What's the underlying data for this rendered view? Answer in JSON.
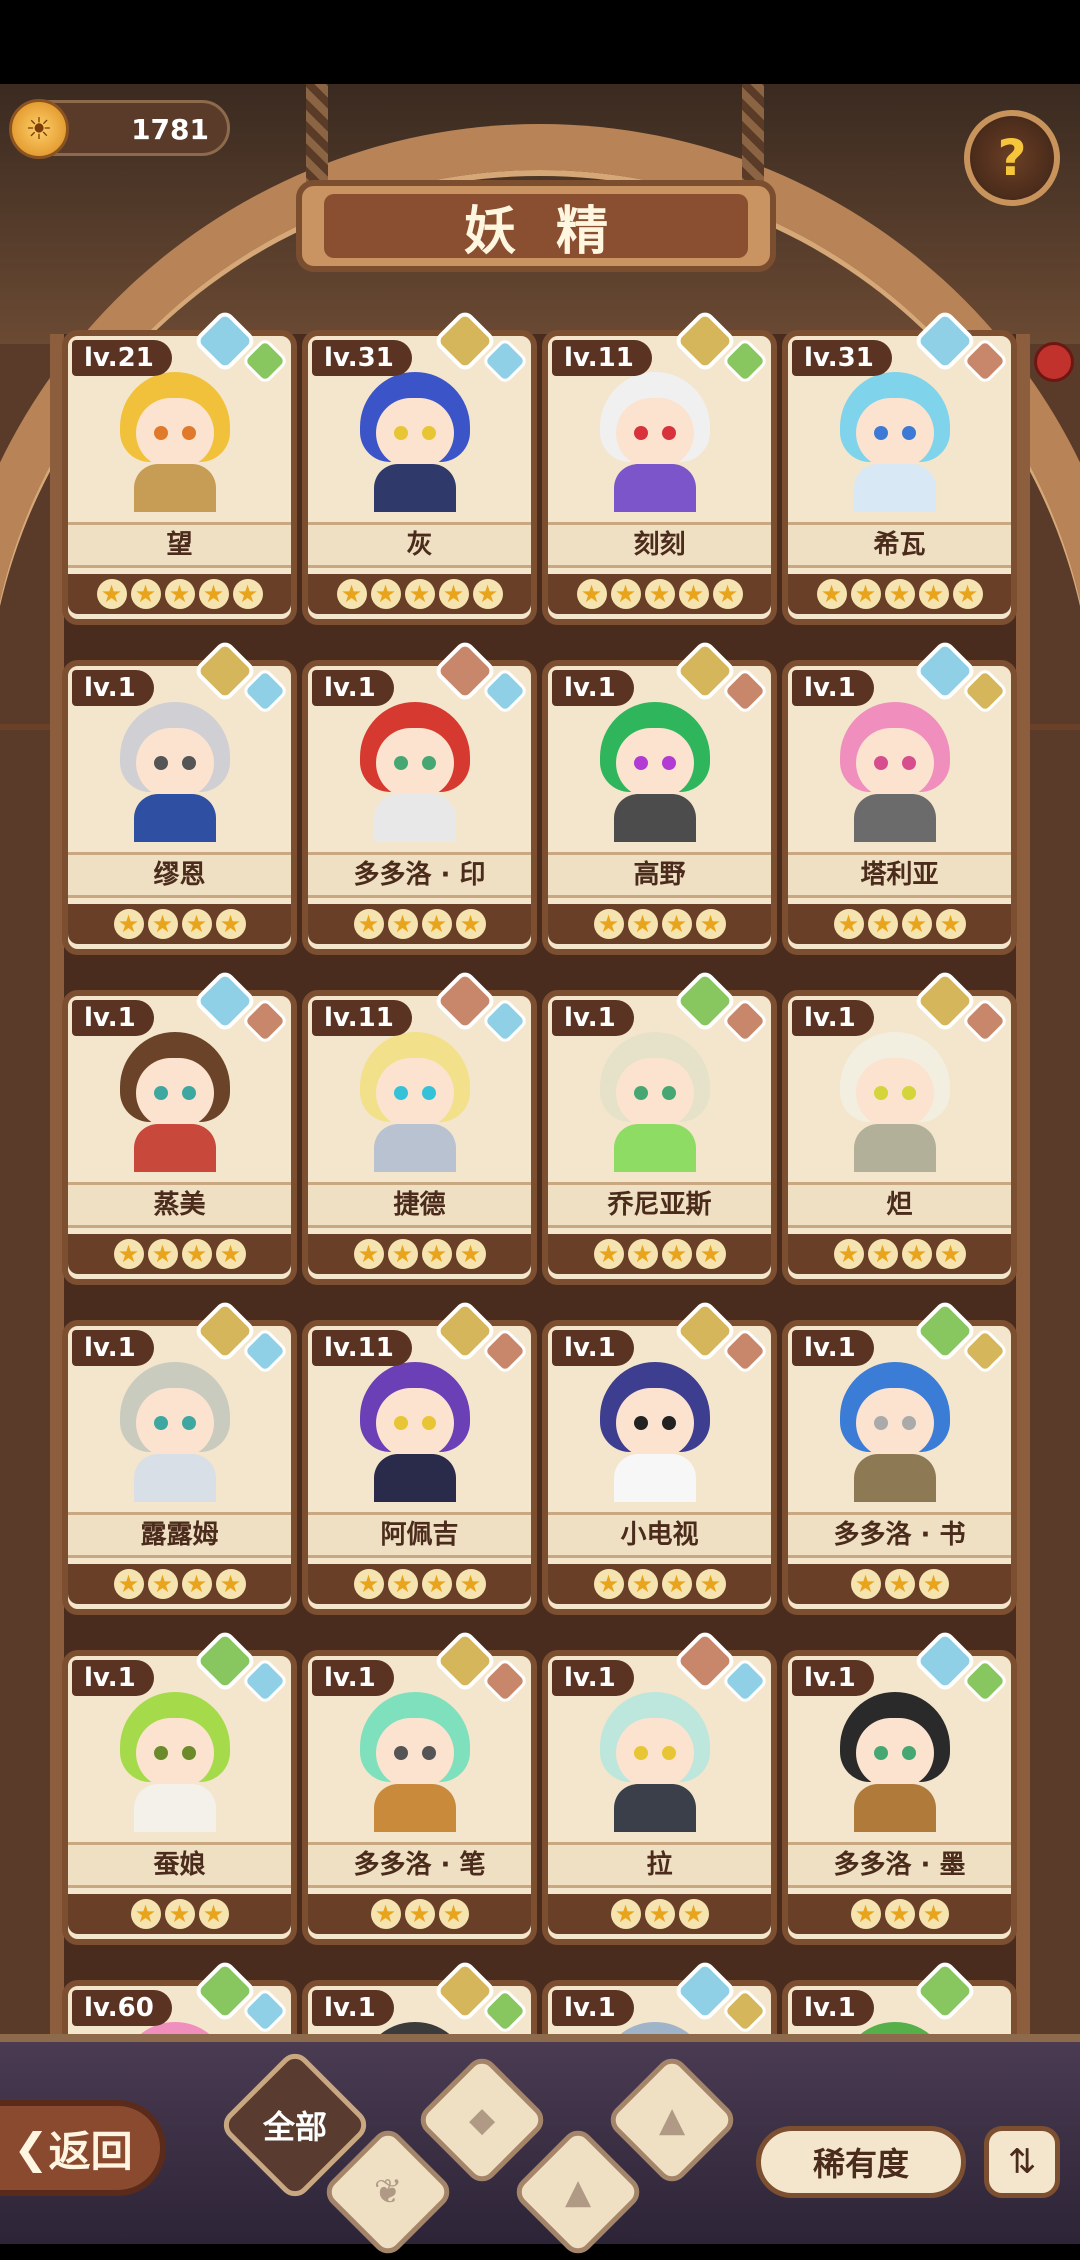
{
  "currency": {
    "value": "1781",
    "icon": "sun-coin-icon"
  },
  "title": "妖精",
  "help_icon": "question-mark-icon",
  "cards": [
    {
      "level": "lv.21",
      "name": "望",
      "stars": 5,
      "hair": "#f2c13b",
      "eye": "#e07a2a",
      "body": "#c79c55",
      "gem1": "water",
      "gem2": "plant"
    },
    {
      "level": "lv.31",
      "name": "灰",
      "stars": 5,
      "hair": "#3b55c9",
      "eye": "#e8c534",
      "body": "#2f3a6b",
      "gem1": "earth",
      "gem2": "water"
    },
    {
      "level": "lv.11",
      "name": "刻刻",
      "stars": 5,
      "hair": "#f1f0f0",
      "eye": "#d8333a",
      "body": "#7b55c9",
      "gem1": "earth",
      "gem2": "plant"
    },
    {
      "level": "lv.31",
      "name": "希瓦",
      "stars": 5,
      "hair": "#7fd3ea",
      "eye": "#3d7ad6",
      "body": "#d9e8f5",
      "gem1": "water",
      "gem2": "fire"
    },
    {
      "level": "lv.1",
      "name": "缪恩",
      "stars": 4,
      "hair": "#cfcfd4",
      "eye": "#555555",
      "body": "#2f4fa3",
      "gem1": "earth",
      "gem2": "water"
    },
    {
      "level": "lv.1",
      "name": "多多洛 · 印",
      "stars": 4,
      "hair": "#d6392f",
      "eye": "#46a773",
      "body": "#e8e8e8",
      "gem1": "fire",
      "gem2": "water"
    },
    {
      "level": "lv.1",
      "name": "高野",
      "stars": 4,
      "hair": "#2fb55b",
      "eye": "#b23bd4",
      "body": "#4c4c4c",
      "gem1": "earth",
      "gem2": "fire"
    },
    {
      "level": "lv.1",
      "name": "塔利亚",
      "stars": 4,
      "hair": "#f08fbd",
      "eye": "#d64e8e",
      "body": "#6b6b6b",
      "gem1": "water",
      "gem2": "earth"
    },
    {
      "level": "lv.1",
      "name": "蒸美",
      "stars": 4,
      "hair": "#6b4328",
      "eye": "#3ea7a0",
      "body": "#c8483b",
      "gem1": "water",
      "gem2": "fire"
    },
    {
      "level": "lv.11",
      "name": "捷德",
      "stars": 4,
      "hair": "#f2e08a",
      "eye": "#35c2d9",
      "body": "#b9c2d1",
      "gem1": "fire",
      "gem2": "water"
    },
    {
      "level": "lv.1",
      "name": "乔尼亚斯",
      "stars": 4,
      "hair": "#e5e2c9",
      "eye": "#46a773",
      "body": "#8edc63",
      "gem1": "plant",
      "gem2": "fire"
    },
    {
      "level": "lv.1",
      "name": "炟",
      "stars": 4,
      "hair": "#f3efe0",
      "eye": "#d4d43b",
      "body": "#b3b09a",
      "gem1": "earth",
      "gem2": "fire"
    },
    {
      "level": "lv.1",
      "name": "露露姆",
      "stars": 4,
      "hair": "#c9cbbf",
      "eye": "#3ea7a0",
      "body": "#d9dfe6",
      "gem1": "earth",
      "gem2": "water"
    },
    {
      "level": "lv.11",
      "name": "阿佩吉",
      "stars": 4,
      "hair": "#6b3fb5",
      "eye": "#e8c534",
      "body": "#2a2a4a",
      "gem1": "earth",
      "gem2": "fire"
    },
    {
      "level": "lv.1",
      "name": "小电视",
      "stars": 4,
      "hair": "#3d3e8f",
      "eye": "#222222",
      "body": "#f7f7f7",
      "gem1": "earth",
      "gem2": "fire"
    },
    {
      "level": "lv.1",
      "name": "多多洛 · 书",
      "stars": 3,
      "hair": "#3a7cd6",
      "eye": "#aaaaaa",
      "body": "#8d7a55",
      "gem1": "plant",
      "gem2": "earth"
    },
    {
      "level": "lv.1",
      "name": "蚕娘",
      "stars": 3,
      "hair": "#a5db4a",
      "eye": "#6b8a2a",
      "body": "#f4f0ea",
      "gem1": "plant",
      "gem2": "water"
    },
    {
      "level": "lv.1",
      "name": "多多洛 · 笔",
      "stars": 3,
      "hair": "#7fe0bd",
      "eye": "#555555",
      "body": "#c98a3b",
      "gem1": "earth",
      "gem2": "fire"
    },
    {
      "level": "lv.1",
      "name": "拉",
      "stars": 3,
      "hair": "#bde6dd",
      "eye": "#e8c534",
      "body": "#3b3f4a",
      "gem1": "fire",
      "gem2": "water"
    },
    {
      "level": "lv.1",
      "name": "多多洛 · 墨",
      "stars": 3,
      "hair": "#2a2a2a",
      "eye": "#46a773",
      "body": "#b07a3b",
      "gem1": "water",
      "gem2": "plant"
    },
    {
      "level": "lv.60",
      "name": "",
      "stars": 0,
      "hair": "#f08fbd",
      "eye": "#555555",
      "body": "#f4f0ea",
      "gem1": "plant",
      "gem2": "water"
    },
    {
      "level": "lv.1",
      "name": "",
      "stars": 0,
      "hair": "#3b3b3b",
      "eye": "#555555",
      "body": "#9a7a5a",
      "gem1": "earth",
      "gem2": "plant"
    },
    {
      "level": "lv.1",
      "name": "",
      "stars": 0,
      "hair": "#9fb3c9",
      "eye": "#555555",
      "body": "#f4e6cc",
      "gem1": "water",
      "gem2": "earth"
    },
    {
      "level": "lv.1",
      "name": "",
      "stars": 0,
      "hair": "#56b04a",
      "eye": "#555555",
      "body": "#56b04a",
      "gem1": "plant",
      "gem2": ""
    }
  ],
  "nav": {
    "back_label": "返回",
    "all_filter_label": "全部",
    "rarity_label": "稀有度",
    "sort_icon": "sort-icon",
    "filters": [
      {
        "name": "plant-filter",
        "icon": "sprout-icon"
      },
      {
        "name": "water-filter",
        "icon": "droplet-icon"
      },
      {
        "name": "earth-filter",
        "icon": "mountain-icon"
      },
      {
        "name": "fire-filter",
        "icon": "volcano-icon"
      }
    ]
  }
}
